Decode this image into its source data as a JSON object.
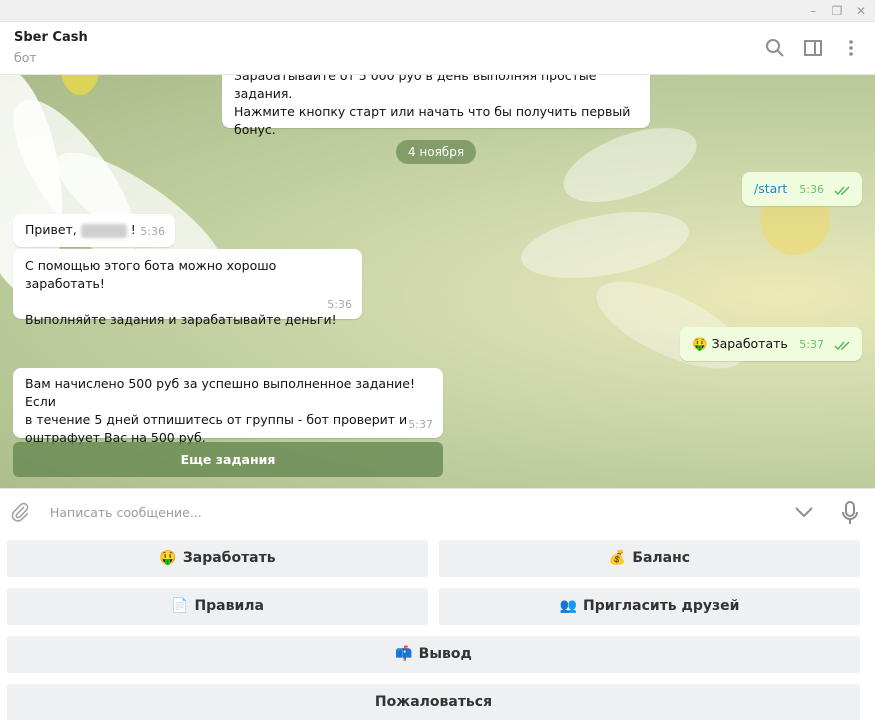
{
  "window": {
    "controls": [
      "–",
      "❐",
      "✕"
    ]
  },
  "header": {
    "title": "Sber Cash",
    "subtitle": "бот"
  },
  "messages": {
    "top_partial": {
      "line1": "Зарабатывайте от 5 000 руб в день выполняя простые задания.",
      "line2": "Нажмите кнопку старт или начать что бы получить первый",
      "line3": "бонус."
    },
    "date": "4 ноября",
    "start": {
      "text": "/start",
      "time": "5:36"
    },
    "greeting": {
      "text_before": "Привет,",
      "text_after": "!",
      "time": "5:36"
    },
    "intro": {
      "line1": "С помощью этого бота можно хорошо заработать!",
      "line2": "Выполняйте задания и зарабатывайте деньги!",
      "time": "5:36"
    },
    "earn_out": {
      "emoji": "🤑",
      "text": "Заработать",
      "time": "5:37"
    },
    "reward": {
      "line1": "Вам начислено 500 руб за успешно выполненное задание! Если",
      "line2": "в течение 5 дней отпишитесь от группы - бот проверит и",
      "line3": "оштрафует Вас на 500 руб.",
      "time": "5:37"
    },
    "inline_button": "Еще задания"
  },
  "composer": {
    "placeholder": "Написать сообщение..."
  },
  "keyboard": {
    "earn": {
      "emoji": "🤑",
      "label": "Заработать"
    },
    "balance": {
      "emoji": "💰",
      "label": "Баланс"
    },
    "rules": {
      "emoji": "📄",
      "label": "Правила"
    },
    "invite": {
      "emoji": "👥",
      "label": "Пригласить друзей"
    },
    "withdraw": {
      "emoji": "📫",
      "label": "Вывод"
    },
    "complain": {
      "label": "Пожаловаться"
    }
  },
  "colors": {
    "outgoing_bubble": "#effdde",
    "incoming_bubble": "#ffffff",
    "read_check": "#5fb55e",
    "keyboard_button": "#eef0f2"
  },
  "icons": [
    "search-icon",
    "sidebar-icon",
    "more-icon",
    "attach-icon",
    "scroll-down-icon",
    "microphone-icon",
    "double-check-icon"
  ]
}
